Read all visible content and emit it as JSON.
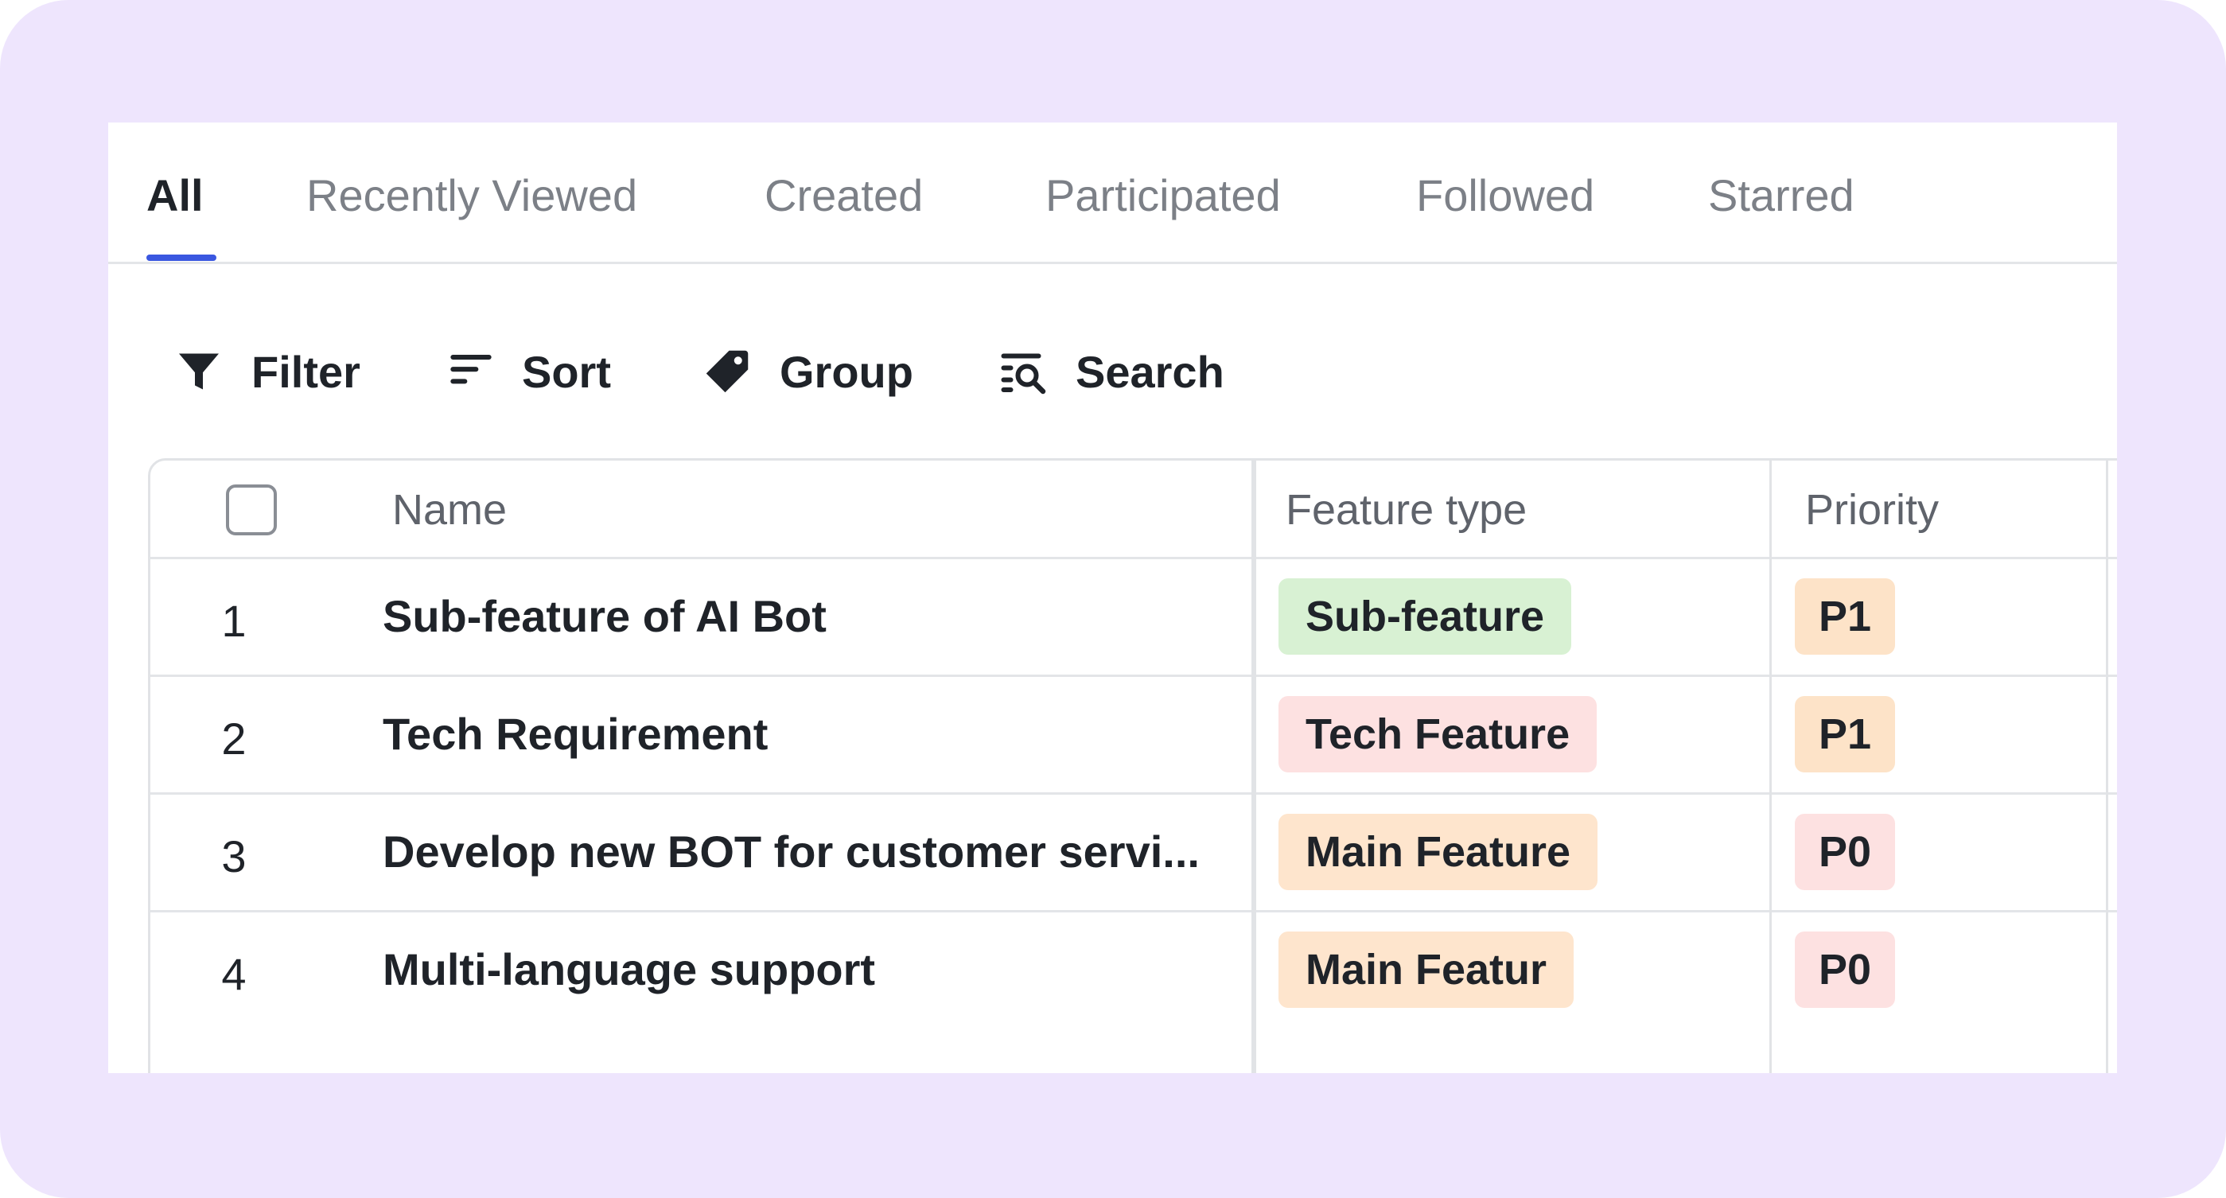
{
  "tabs": [
    {
      "label": "All",
      "active": true
    },
    {
      "label": "Recently Viewed",
      "active": false
    },
    {
      "label": "Created",
      "active": false
    },
    {
      "label": "Participated",
      "active": false
    },
    {
      "label": "Followed",
      "active": false
    },
    {
      "label": "Starred",
      "active": false
    }
  ],
  "toolbar": {
    "filter": {
      "label": "Filter",
      "icon": "funnel-icon"
    },
    "sort": {
      "label": "Sort",
      "icon": "sort-lines-icon"
    },
    "group": {
      "label": "Group",
      "icon": "tag-icon"
    },
    "search": {
      "label": "Search",
      "icon": "search-list-icon"
    }
  },
  "table": {
    "columns": [
      "Name",
      "Feature type",
      "Priority"
    ],
    "rows": [
      {
        "num": "1",
        "name": "Sub-feature of AI Bot",
        "feature_type": "Sub-feature",
        "feature_color": "#d8f1d3",
        "priority": "P1",
        "priority_color": "#fde3c8"
      },
      {
        "num": "2",
        "name": "Tech Requirement",
        "feature_type": "Tech Feature",
        "feature_color": "#fde1e1",
        "priority": "P1",
        "priority_color": "#fde3c8"
      },
      {
        "num": "3",
        "name": "Develop new BOT for customer servi...",
        "feature_type": "Main Feature",
        "feature_color": "#fee5cd",
        "priority": "P0",
        "priority_color": "#fde1e1"
      },
      {
        "num": "4",
        "name": "Multi-language support",
        "feature_type": "Main Featur",
        "feature_color": "#fee5cd",
        "priority": "P0",
        "priority_color": "#fde1e1"
      }
    ]
  },
  "colors": {
    "background": "#eee5fd",
    "accent": "#3a57e0"
  }
}
